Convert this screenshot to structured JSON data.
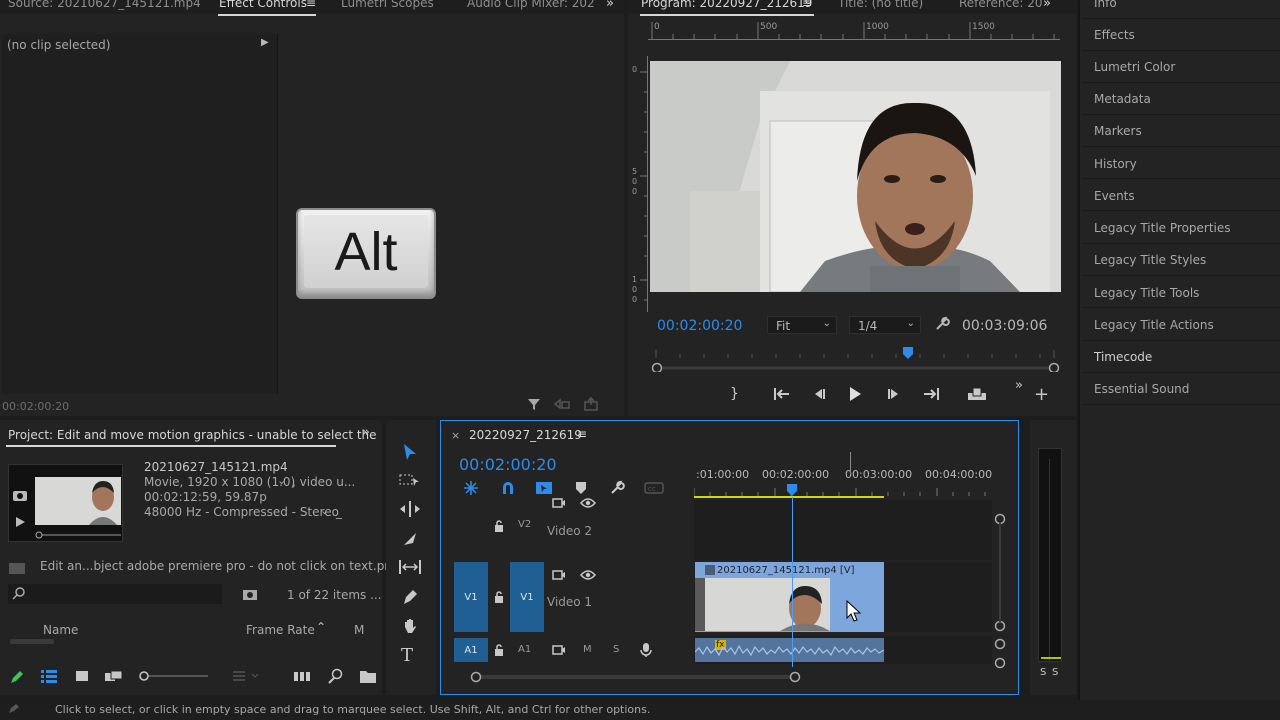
{
  "source_tabs": {
    "source": "Source: 20210627_145121.mp4",
    "effect_controls": "Effect Controls",
    "lumetri_scopes": "Lumetri Scopes",
    "audio_mixer": "Audio Clip Mixer: 202"
  },
  "program_tabs": {
    "program": "Program: 20220927_212619",
    "title": "Title: (no title)",
    "reference": "Reference: 20"
  },
  "effect_controls": {
    "no_clip": "(no clip selected)",
    "timecode": "00:02:00:20"
  },
  "overlay_key": "Alt",
  "program": {
    "ruler": [
      "0",
      "500",
      "1000",
      "1500"
    ],
    "timecode": "00:02:00:20",
    "fit": "Fit",
    "resolution": "1/4",
    "duration": "00:03:09:06"
  },
  "right_panel": {
    "items": [
      "Info",
      "Effects",
      "Lumetri Color",
      "Metadata",
      "Markers",
      "History",
      "Events",
      "Legacy Title Properties",
      "Legacy Title Styles",
      "Legacy Title Tools",
      "Legacy Title Actions",
      "Timecode",
      "Essential Sound"
    ]
  },
  "project": {
    "tab": "Project: Edit and move motion graphics - unable to select the",
    "clip_name": "20210627_145121.mp4",
    "clip_info1": "Movie, 1920 x 1080 (1.0)",
    "clip_info1b": ", video u...",
    "clip_info2": "00:02:12:59, 59.87p",
    "clip_info3": "48000 Hz - Compressed - Stereo",
    "clip_info3b": "_",
    "project_file": "Edit an...bject adobe premiere pro - do not click on text.prproj",
    "items_count": "1 of 22 items ...",
    "col_name": "Name",
    "col_frame_rate": "Frame Rate",
    "col_m": "M"
  },
  "timeline": {
    "tab": "20220927_212619",
    "timecode": "00:02:00:20",
    "ruler": [
      ":01:00:00",
      "00:02:00:00",
      "00:03:00:00",
      "00:04:00:00"
    ],
    "v2": "V2",
    "v1": "V1",
    "a1": "A1",
    "video2": "Video 2",
    "video1": "Video 1",
    "m": "M",
    "s": "S",
    "clip": "20210627_145121.mp4 [V]",
    "fx": "fx"
  },
  "meter": {
    "s1": "S",
    "s2": "S"
  },
  "status": "Click to select, or click in empty space and drag to marquee select. Use Shift, Alt, and Ctrl for other options.",
  "colors": {
    "accent": "#2d8ceb",
    "clip": "#7ca6dc",
    "in_out": "#d6d600"
  }
}
